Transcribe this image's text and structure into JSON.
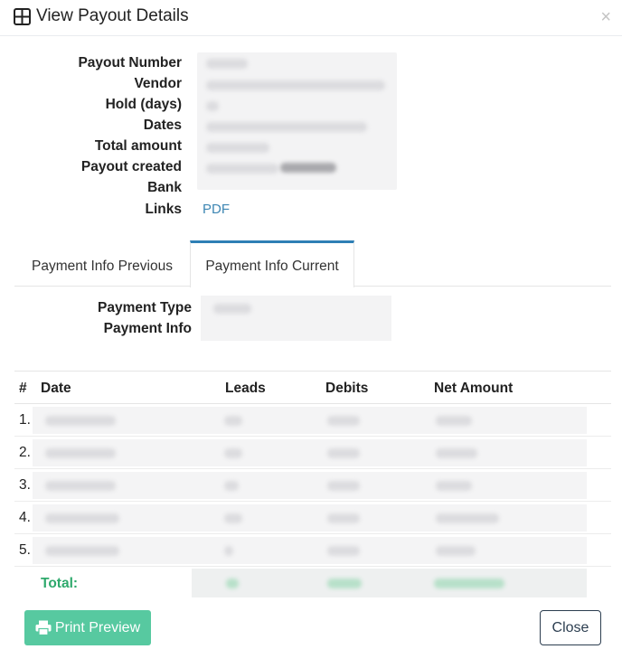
{
  "header": {
    "title": "View Payout Details",
    "icon": "grid-icon",
    "close_glyph": "×"
  },
  "details": {
    "labels": [
      "Payout Number",
      "Vendor",
      "Hold (days)",
      "Dates",
      "Total amount",
      "Payout created",
      "Bank",
      "Links"
    ],
    "links_value": "PDF"
  },
  "tabs": [
    {
      "label": "Payment Info Previous",
      "active": false
    },
    {
      "label": "Payment Info Current",
      "active": true
    }
  ],
  "payment_info": {
    "labels": [
      "Payment Type",
      "Payment Info"
    ]
  },
  "table": {
    "headers": [
      "#",
      "Date",
      "Leads",
      "Debits",
      "Net Amount"
    ],
    "row_numbers": [
      "1.",
      "2.",
      "3.",
      "4.",
      "5."
    ],
    "total_label": "Total:"
  },
  "footer": {
    "print_label": "Print Preview",
    "close_label": "Close"
  },
  "colors": {
    "accent_blue": "#2e7fb5",
    "link_blue": "#3d86b3",
    "total_green": "#2ea96c",
    "print_button": "#57c9a0",
    "close_border": "#2c3e50"
  }
}
